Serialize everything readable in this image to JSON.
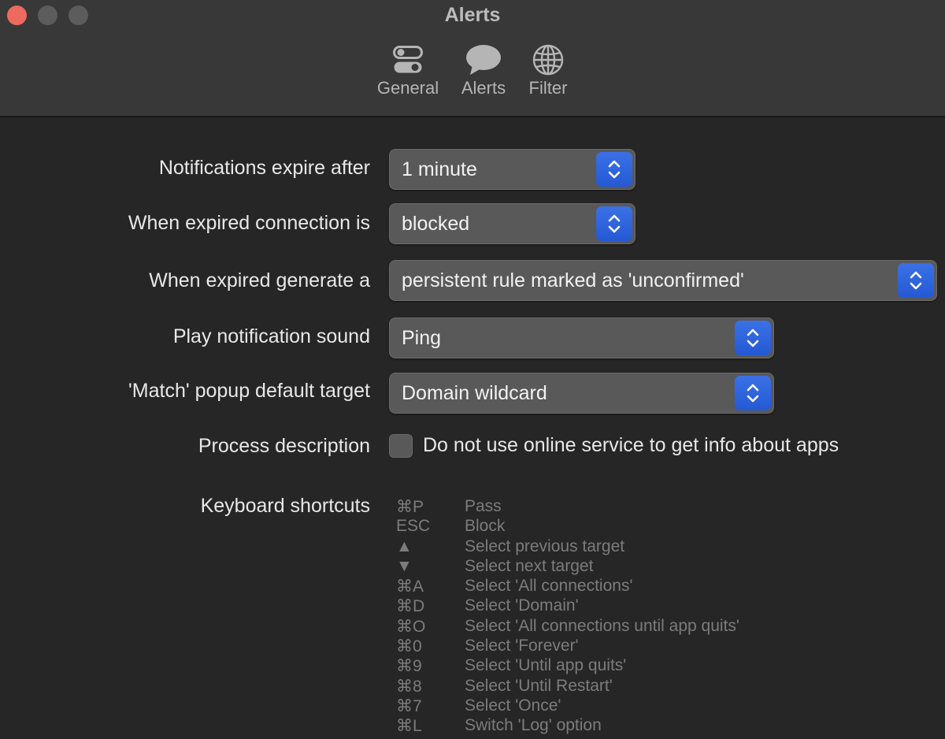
{
  "window": {
    "title": "Alerts"
  },
  "toolbar": {
    "tabs": [
      {
        "label": "General",
        "icon": "toggles-icon"
      },
      {
        "label": "Alerts",
        "icon": "speech-bubble-icon"
      },
      {
        "label": "Filter",
        "icon": "globe-icon"
      }
    ]
  },
  "settings": {
    "expire": {
      "label": "Notifications expire after",
      "value": "1 minute"
    },
    "expired_connection": {
      "label": "When expired connection is",
      "value": "blocked"
    },
    "expired_generate": {
      "label": "When expired generate a",
      "value": "persistent rule marked as 'unconfirmed'"
    },
    "sound": {
      "label": "Play notification sound",
      "value": "Ping"
    },
    "match_target": {
      "label": "'Match' popup default target",
      "value": "Domain wildcard"
    },
    "process_description": {
      "label": "Process description",
      "checkbox_label": "Do not use online service to get info about apps",
      "checked": false
    },
    "shortcuts": {
      "label": "Keyboard shortcuts",
      "items": [
        {
          "key": "⌘P",
          "desc": "Pass"
        },
        {
          "key": "ESC",
          "desc": "Block"
        },
        {
          "key": "▲",
          "desc": "Select previous target"
        },
        {
          "key": "▼",
          "desc": "Select next target"
        },
        {
          "key": "⌘A",
          "desc": "Select 'All connections'"
        },
        {
          "key": "⌘D",
          "desc": "Select 'Domain'"
        },
        {
          "key": "⌘O",
          "desc": "Select 'All connections until app quits'"
        },
        {
          "key": "⌘0",
          "desc": "Select 'Forever'"
        },
        {
          "key": "⌘9",
          "desc": "Select 'Until app quits'"
        },
        {
          "key": "⌘8",
          "desc": "Select 'Until Restart'"
        },
        {
          "key": "⌘7",
          "desc": "Select 'Once'"
        },
        {
          "key": "⌘L",
          "desc": "Switch 'Log' option"
        }
      ]
    }
  },
  "colors": {
    "background": "#262626",
    "toolbar": "#383838",
    "accent": "#2f66dd",
    "close": "#ed6a5e"
  }
}
